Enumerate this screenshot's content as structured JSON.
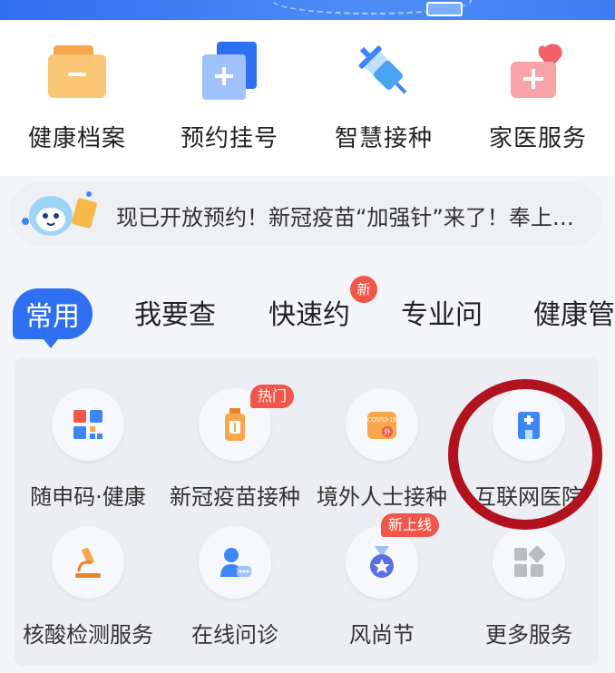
{
  "quick_actions": [
    {
      "label": "健康档案",
      "icon": "folder-icon",
      "color": "#f7a64a"
    },
    {
      "label": "预约挂号",
      "icon": "medical-plus-icon",
      "color": "#3f86f5"
    },
    {
      "label": "智慧接种",
      "icon": "syringe-icon",
      "color": "#4aa3f0"
    },
    {
      "label": "家医服务",
      "icon": "medical-kit-heart-icon",
      "color": "#f2606a"
    }
  ],
  "notice": {
    "text": "现已开放预约！新冠疫苗“加强针”来了！奉上…",
    "icon": "mascot-icon"
  },
  "tabs": [
    {
      "label": "常用",
      "active": true
    },
    {
      "label": "我要查"
    },
    {
      "label": "快速约",
      "badge": "新"
    },
    {
      "label": "专业问"
    },
    {
      "label": "健康管"
    }
  ],
  "services": [
    {
      "label": "随申码·健康",
      "icon": "qr-code-icon"
    },
    {
      "label": "新冠疫苗接种",
      "icon": "vaccine-bottle-icon",
      "tag": "热门"
    },
    {
      "label": "境外人士接种",
      "icon": "covid-vaccine-icon",
      "icon_text": "COVID-19",
      "icon_text2": "外"
    },
    {
      "label": "互联网医院",
      "icon": "hospital-icon"
    },
    {
      "label": "核酸检测服务",
      "icon": "microscope-icon"
    },
    {
      "label": "在线问诊",
      "icon": "doctor-chat-icon"
    },
    {
      "label": "风尚节",
      "icon": "medal-icon",
      "tag": "新上线"
    },
    {
      "label": "更多服务",
      "icon": "more-grid-icon"
    }
  ],
  "colors": {
    "primary": "#2f6ff1",
    "badge": "#f0574a",
    "highlight_ring": "#b0121e"
  }
}
